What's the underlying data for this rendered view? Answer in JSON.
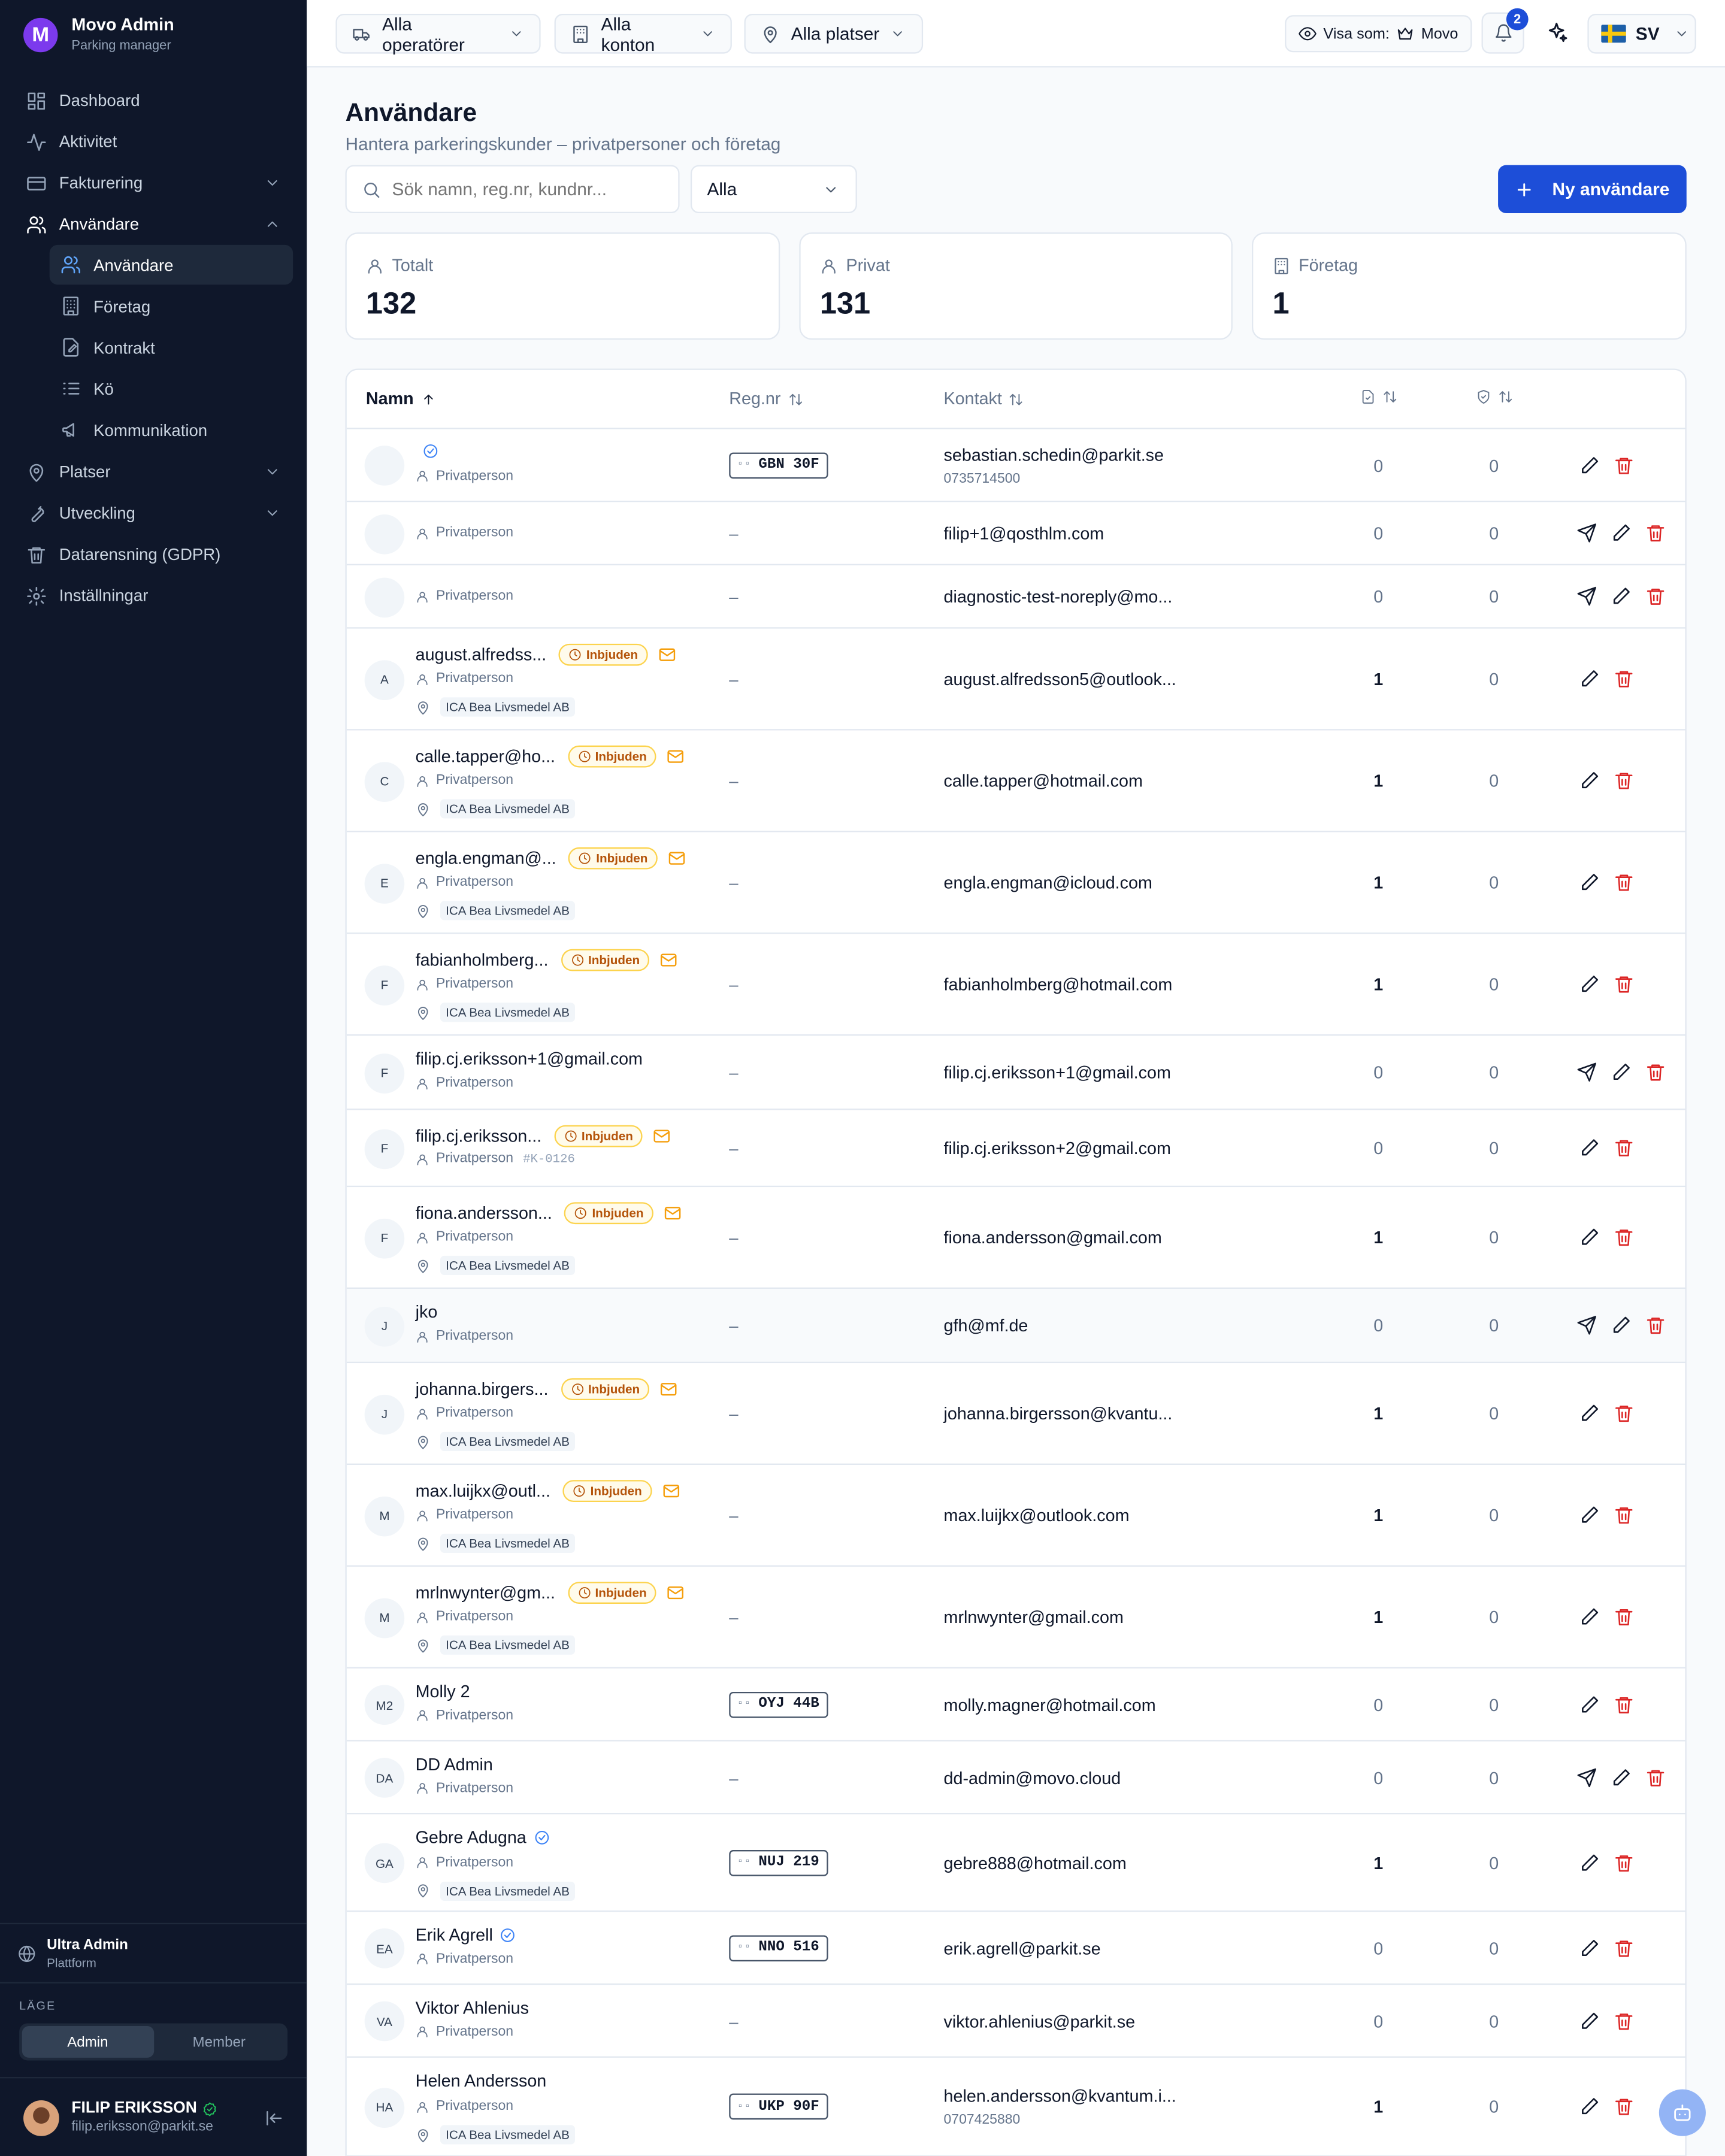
{
  "app": {
    "title": "Movo Admin",
    "subtitle": "Parking manager",
    "logo_letter": "M"
  },
  "sidebar": {
    "items": [
      {
        "label": "Dashboard",
        "icon": "grid-icon"
      },
      {
        "label": "Aktivitet",
        "icon": "activity-icon"
      },
      {
        "label": "Fakturering",
        "icon": "card-icon"
      },
      {
        "label": "Användare",
        "icon": "users-icon"
      },
      {
        "label": "Platser",
        "icon": "pin-icon"
      },
      {
        "label": "Utveckling",
        "icon": "wrench-icon"
      },
      {
        "label": "Datarensning (GDPR)",
        "icon": "trash-icon"
      },
      {
        "label": "Inställningar",
        "icon": "gear-icon"
      }
    ],
    "subitems": [
      {
        "label": "Användare",
        "icon": "users-icon"
      },
      {
        "label": "Företag",
        "icon": "building-icon"
      },
      {
        "label": "Kontrakt",
        "icon": "contract-icon"
      },
      {
        "label": "Kö",
        "icon": "list-icon"
      },
      {
        "label": "Kommunikation",
        "icon": "megaphone-icon"
      }
    ],
    "org_name": "Ultra Admin",
    "org_sub": "Plattform",
    "mode_label": "LÄGE",
    "mode_admin": "Admin",
    "mode_member": "Member",
    "user_name": "FILIP ERIKSSON",
    "user_email": "filip.eriksson@parkit.se"
  },
  "topbar": {
    "operators": "Alla operatörer",
    "accounts": "Alla konton",
    "places": "Alla platser",
    "view_as_label": "Visa som:",
    "view_as_value": "Movo",
    "notifications": "2",
    "language": "SV"
  },
  "page": {
    "title": "Användare",
    "subtitle": "Hantera parkeringskunder – privatpersoner och företag",
    "search_placeholder": "Sök namn, reg.nr, kundnr...",
    "filter_value": "Alla",
    "new_button": "Ny användare"
  },
  "stats": [
    {
      "label": "Totalt",
      "value": "132"
    },
    {
      "label": "Privat",
      "value": "131"
    },
    {
      "label": "Företag",
      "value": "1"
    }
  ],
  "table": {
    "col_name": "Namn",
    "col_reg": "Reg.nr",
    "col_contact": "Kontakt",
    "invited_label": "Inbjuden",
    "type_label": "Privatperson",
    "rows": [
      {
        "initials": "",
        "name": "",
        "verified": true,
        "invited": false,
        "type": "Privatperson",
        "company": "",
        "kid": "",
        "plate": "GBN 30F",
        "email": "sebastian.schedin@parkit.se",
        "phone": "0735714500",
        "c1": "0",
        "c2": "0",
        "send": false
      },
      {
        "initials": "",
        "name": "",
        "verified": false,
        "invited": false,
        "type": "Privatperson",
        "company": "",
        "kid": "",
        "plate": "",
        "email": "filip+1@qosthlm.com",
        "phone": "",
        "c1": "0",
        "c2": "0",
        "send": true
      },
      {
        "initials": "",
        "name": "",
        "verified": false,
        "invited": false,
        "type": "Privatperson",
        "company": "",
        "kid": "",
        "plate": "",
        "email": "diagnostic-test-noreply@mo...",
        "phone": "",
        "c1": "0",
        "c2": "0",
        "send": true
      },
      {
        "initials": "A",
        "name": "august.alfredss...",
        "verified": false,
        "invited": true,
        "type": "Privatperson",
        "company": "ICA Bea Livsmedel AB",
        "kid": "",
        "plate": "",
        "email": "august.alfredsson5@outlook...",
        "phone": "",
        "c1": "1",
        "c2": "0",
        "send": false
      },
      {
        "initials": "C",
        "name": "calle.tapper@ho...",
        "verified": false,
        "invited": true,
        "type": "Privatperson",
        "company": "ICA Bea Livsmedel AB",
        "kid": "",
        "plate": "",
        "email": "calle.tapper@hotmail.com",
        "phone": "",
        "c1": "1",
        "c2": "0",
        "send": false
      },
      {
        "initials": "E",
        "name": "engla.engman@...",
        "verified": false,
        "invited": true,
        "type": "Privatperson",
        "company": "ICA Bea Livsmedel AB",
        "kid": "",
        "plate": "",
        "email": "engla.engman@icloud.com",
        "phone": "",
        "c1": "1",
        "c2": "0",
        "send": false
      },
      {
        "initials": "F",
        "name": "fabianholmberg...",
        "verified": false,
        "invited": true,
        "type": "Privatperson",
        "company": "ICA Bea Livsmedel AB",
        "kid": "",
        "plate": "",
        "email": "fabianholmberg@hotmail.com",
        "phone": "",
        "c1": "1",
        "c2": "0",
        "send": false
      },
      {
        "initials": "F",
        "name": "filip.cj.eriksson+1@gmail.com",
        "verified": false,
        "invited": false,
        "type": "Privatperson",
        "company": "",
        "kid": "",
        "plate": "",
        "email": "filip.cj.eriksson+1@gmail.com",
        "phone": "",
        "c1": "0",
        "c2": "0",
        "send": true
      },
      {
        "initials": "F",
        "name": "filip.cj.eriksson...",
        "verified": false,
        "invited": true,
        "type": "Privatperson",
        "company": "",
        "kid": "#K-0126",
        "plate": "",
        "email": "filip.cj.eriksson+2@gmail.com",
        "phone": "",
        "c1": "0",
        "c2": "0",
        "send": false
      },
      {
        "initials": "F",
        "name": "fiona.andersson...",
        "verified": false,
        "invited": true,
        "type": "Privatperson",
        "company": "ICA Bea Livsmedel AB",
        "kid": "",
        "plate": "",
        "email": "fiona.andersson@gmail.com",
        "phone": "",
        "c1": "1",
        "c2": "0",
        "send": false
      },
      {
        "initials": "J",
        "name": "jko",
        "verified": false,
        "invited": false,
        "type": "Privatperson",
        "company": "",
        "kid": "",
        "plate": "",
        "email": "gfh@mf.de",
        "phone": "",
        "c1": "0",
        "c2": "0",
        "send": true
      },
      {
        "initials": "J",
        "name": "johanna.birgers...",
        "verified": false,
        "invited": true,
        "type": "Privatperson",
        "company": "ICA Bea Livsmedel AB",
        "kid": "",
        "plate": "",
        "email": "johanna.birgersson@kvantu...",
        "phone": "",
        "c1": "1",
        "c2": "0",
        "send": false
      },
      {
        "initials": "M",
        "name": "max.luijkx@outl...",
        "verified": false,
        "invited": true,
        "type": "Privatperson",
        "company": "ICA Bea Livsmedel AB",
        "kid": "",
        "plate": "",
        "email": "max.luijkx@outlook.com",
        "phone": "",
        "c1": "1",
        "c2": "0",
        "send": false
      },
      {
        "initials": "M",
        "name": "mrlnwynter@gm...",
        "verified": false,
        "invited": true,
        "type": "Privatperson",
        "company": "ICA Bea Livsmedel AB",
        "kid": "",
        "plate": "",
        "email": "mrlnwynter@gmail.com",
        "phone": "",
        "c1": "1",
        "c2": "0",
        "send": false
      },
      {
        "initials": "M2",
        "name": "Molly 2",
        "verified": false,
        "invited": false,
        "type": "Privatperson",
        "company": "",
        "kid": "",
        "plate": "OYJ 44B",
        "email": "molly.magner@hotmail.com",
        "phone": "",
        "c1": "0",
        "c2": "0",
        "send": false
      },
      {
        "initials": "DA",
        "name": "DD Admin",
        "verified": false,
        "invited": false,
        "type": "Privatperson",
        "company": "",
        "kid": "",
        "plate": "",
        "email": "dd-admin@movo.cloud",
        "phone": "",
        "c1": "0",
        "c2": "0",
        "send": true
      },
      {
        "initials": "GA",
        "name": "Gebre Adugna",
        "verified": true,
        "invited": false,
        "type": "Privatperson",
        "company": "ICA Bea Livsmedel AB",
        "kid": "",
        "plate": "NUJ 219",
        "email": "gebre888@hotmail.com",
        "phone": "",
        "c1": "1",
        "c2": "0",
        "send": false
      },
      {
        "initials": "EA",
        "name": "Erik Agrell",
        "verified": true,
        "invited": false,
        "type": "Privatperson",
        "company": "",
        "kid": "",
        "plate": "NNO 516",
        "email": "erik.agrell@parkit.se",
        "phone": "",
        "c1": "0",
        "c2": "0",
        "send": false
      },
      {
        "initials": "VA",
        "name": "Viktor Ahlenius",
        "verified": false,
        "invited": false,
        "type": "Privatperson",
        "company": "",
        "kid": "",
        "plate": "",
        "email": "viktor.ahlenius@parkit.se",
        "phone": "",
        "c1": "0",
        "c2": "0",
        "send": false
      },
      {
        "initials": "HA",
        "name": "Helen Andersson",
        "verified": false,
        "invited": false,
        "type": "Privatperson",
        "company": "ICA Bea Livsmedel AB",
        "kid": "",
        "plate": "UKP 90F",
        "email": "helen.andersson@kvantum.i...",
        "phone": "0707425880",
        "c1": "1",
        "c2": "0",
        "send": false
      }
    ]
  }
}
